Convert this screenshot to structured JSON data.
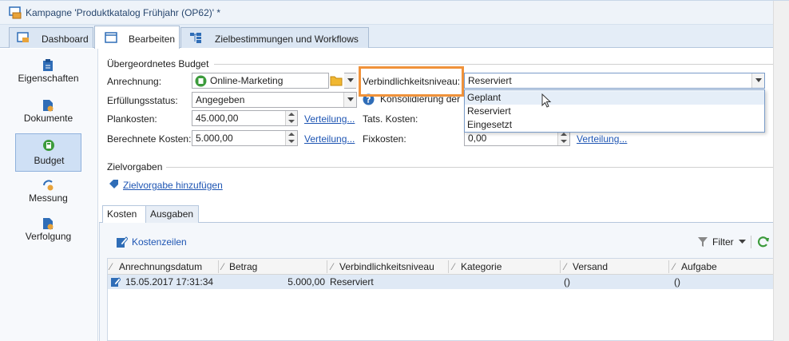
{
  "window": {
    "title": "Kampagne 'Produktkatalog Frühjahr (OP62)' *"
  },
  "tabs": [
    {
      "label": "Dashboard"
    },
    {
      "label": "Bearbeiten"
    },
    {
      "label": "Zielbestimmungen und Workflows"
    }
  ],
  "sidebar": {
    "items": [
      {
        "label": "Eigenschaften"
      },
      {
        "label": "Dokumente"
      },
      {
        "label": "Budget"
      },
      {
        "label": "Messung"
      },
      {
        "label": "Verfolgung"
      }
    ]
  },
  "budget": {
    "group_label": "Übergeordnetes Budget",
    "anrechnung_label": "Anrechnung:",
    "anrechnung_value": "Online-Marketing",
    "erfuellung_label": "Erfüllungsstatus:",
    "erfuellung_value": "Angegeben",
    "plankosten_label": "Plankosten:",
    "plankosten_value": "45.000,00",
    "berechnete_label": "Berechnete Kosten:",
    "berechnete_value": "5.000,00",
    "verteilung_link": "Verteilung...",
    "verbindlichkeit_label": "Verbindlichkeitsniveau:",
    "verbindlichkeit_value": "Reserviert",
    "konsolidierung_label": "Konsolidierung der K",
    "tats_label": "Tats. Kosten:",
    "fixkosten_label": "Fixkosten:",
    "fixkosten_value": "0,00"
  },
  "dropdown": {
    "options": [
      "Geplant",
      "Reserviert",
      "Eingesetzt"
    ]
  },
  "zielvorgaben": {
    "group_label": "Zielvorgaben",
    "add_link": "Zielvorgabe hinzufügen"
  },
  "subtabs": [
    {
      "label": "Kosten"
    },
    {
      "label": "Ausgaben"
    }
  ],
  "costs": {
    "toolbar_label": "Kostenzeilen",
    "filter_label": "Filter",
    "columns": [
      "Anrechnungsdatum",
      "Betrag",
      "Verbindlichkeitsniveau",
      "Kategorie",
      "Versand",
      "Aufgabe"
    ],
    "rows": [
      {
        "date": "15.05.2017 17:31:34",
        "betrag": "5.000,00",
        "niveau": "Reserviert",
        "kategorie": "",
        "versand": "()",
        "aufgabe": "()"
      }
    ]
  },
  "colors": {
    "accent_orange": "#f0923a",
    "link_blue": "#1e55b3",
    "active_nav": "#cfe0f5",
    "icon_blue": "#2f6db7",
    "icon_green": "#3c9b3c"
  }
}
